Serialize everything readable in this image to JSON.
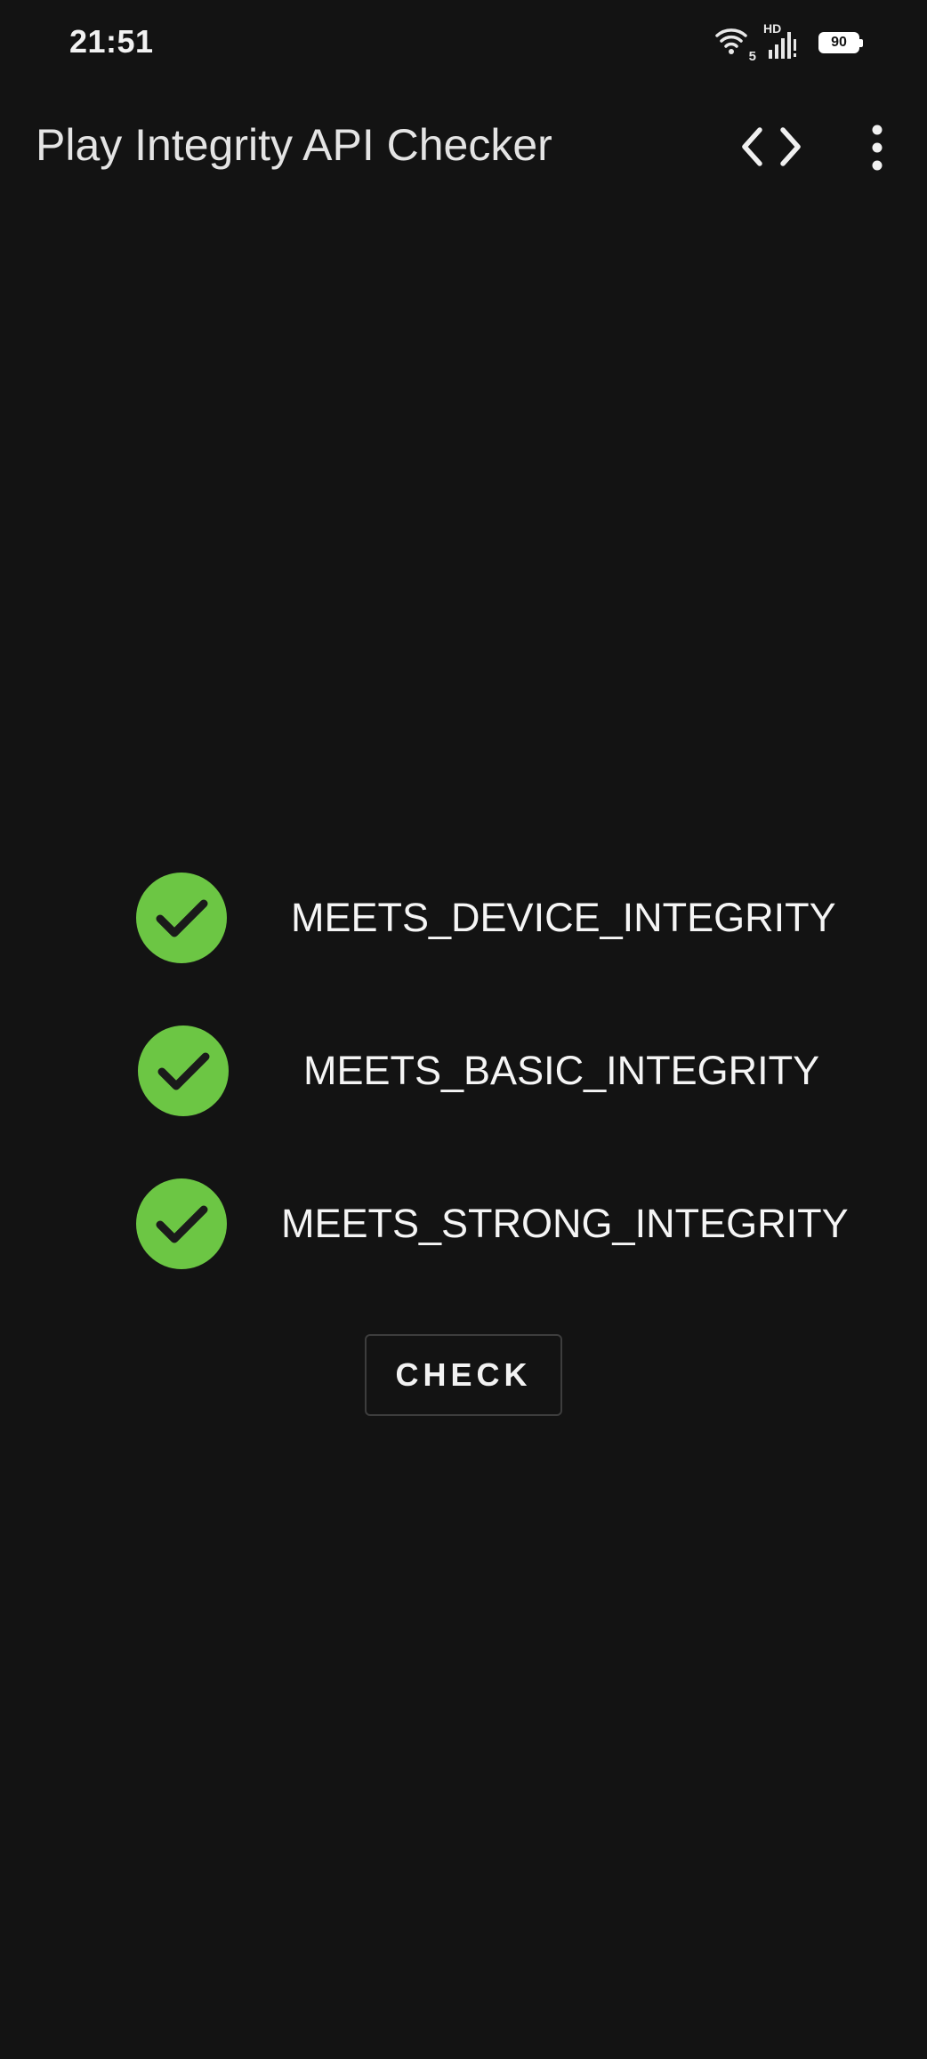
{
  "status_bar": {
    "time": "21:51",
    "wifi_badge": "5",
    "network_label": "HD",
    "battery_level": "90"
  },
  "app_bar": {
    "title": "Play Integrity API Checker",
    "code_icon": "code-brackets-icon",
    "menu_icon": "more-vertical-icon"
  },
  "results": [
    {
      "label": "MEETS_DEVICE_INTEGRITY",
      "status": "passed",
      "icon": "check-circle-icon"
    },
    {
      "label": "MEETS_BASIC_INTEGRITY",
      "status": "passed",
      "icon": "check-circle-icon"
    },
    {
      "label": "MEETS_STRONG_INTEGRITY",
      "status": "passed",
      "icon": "check-circle-icon"
    }
  ],
  "check_button": {
    "label": "CHECK"
  },
  "colors": {
    "background": "#131313",
    "pass_green": "#6cc644",
    "text": "#f5f5f5",
    "button_border": "#3d3d3d"
  }
}
